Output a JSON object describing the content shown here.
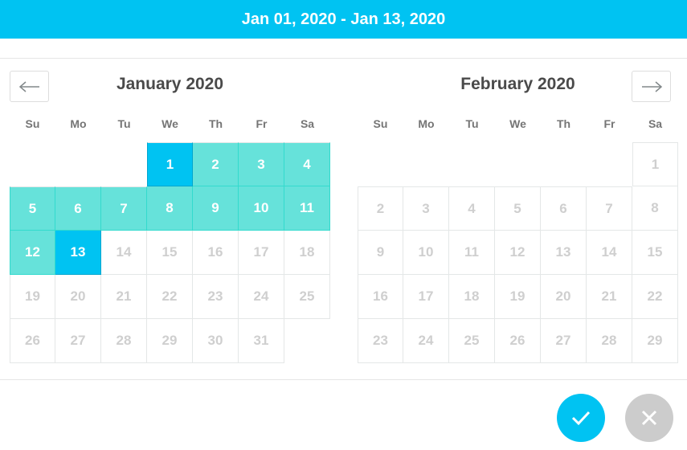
{
  "header": {
    "range_text": "Jan 01, 2020 - Jan 13, 2020"
  },
  "weekdays": [
    "Su",
    "Mo",
    "Tu",
    "We",
    "Th",
    "Fr",
    "Sa"
  ],
  "months": [
    {
      "title": "January 2020",
      "first_weekday": 3,
      "days_in_month": 31,
      "range_start": 1,
      "range_end": 13
    },
    {
      "title": "February 2020",
      "first_weekday": 6,
      "days_in_month": 29,
      "range_start": null,
      "range_end": null
    }
  ],
  "icons": {
    "prev": "arrow-left-icon",
    "next": "arrow-right-icon",
    "confirm": "check-icon",
    "cancel": "close-icon"
  },
  "colors": {
    "accent": "#00c3f2",
    "range": "#66e2da",
    "cancel": "#cccccc"
  }
}
